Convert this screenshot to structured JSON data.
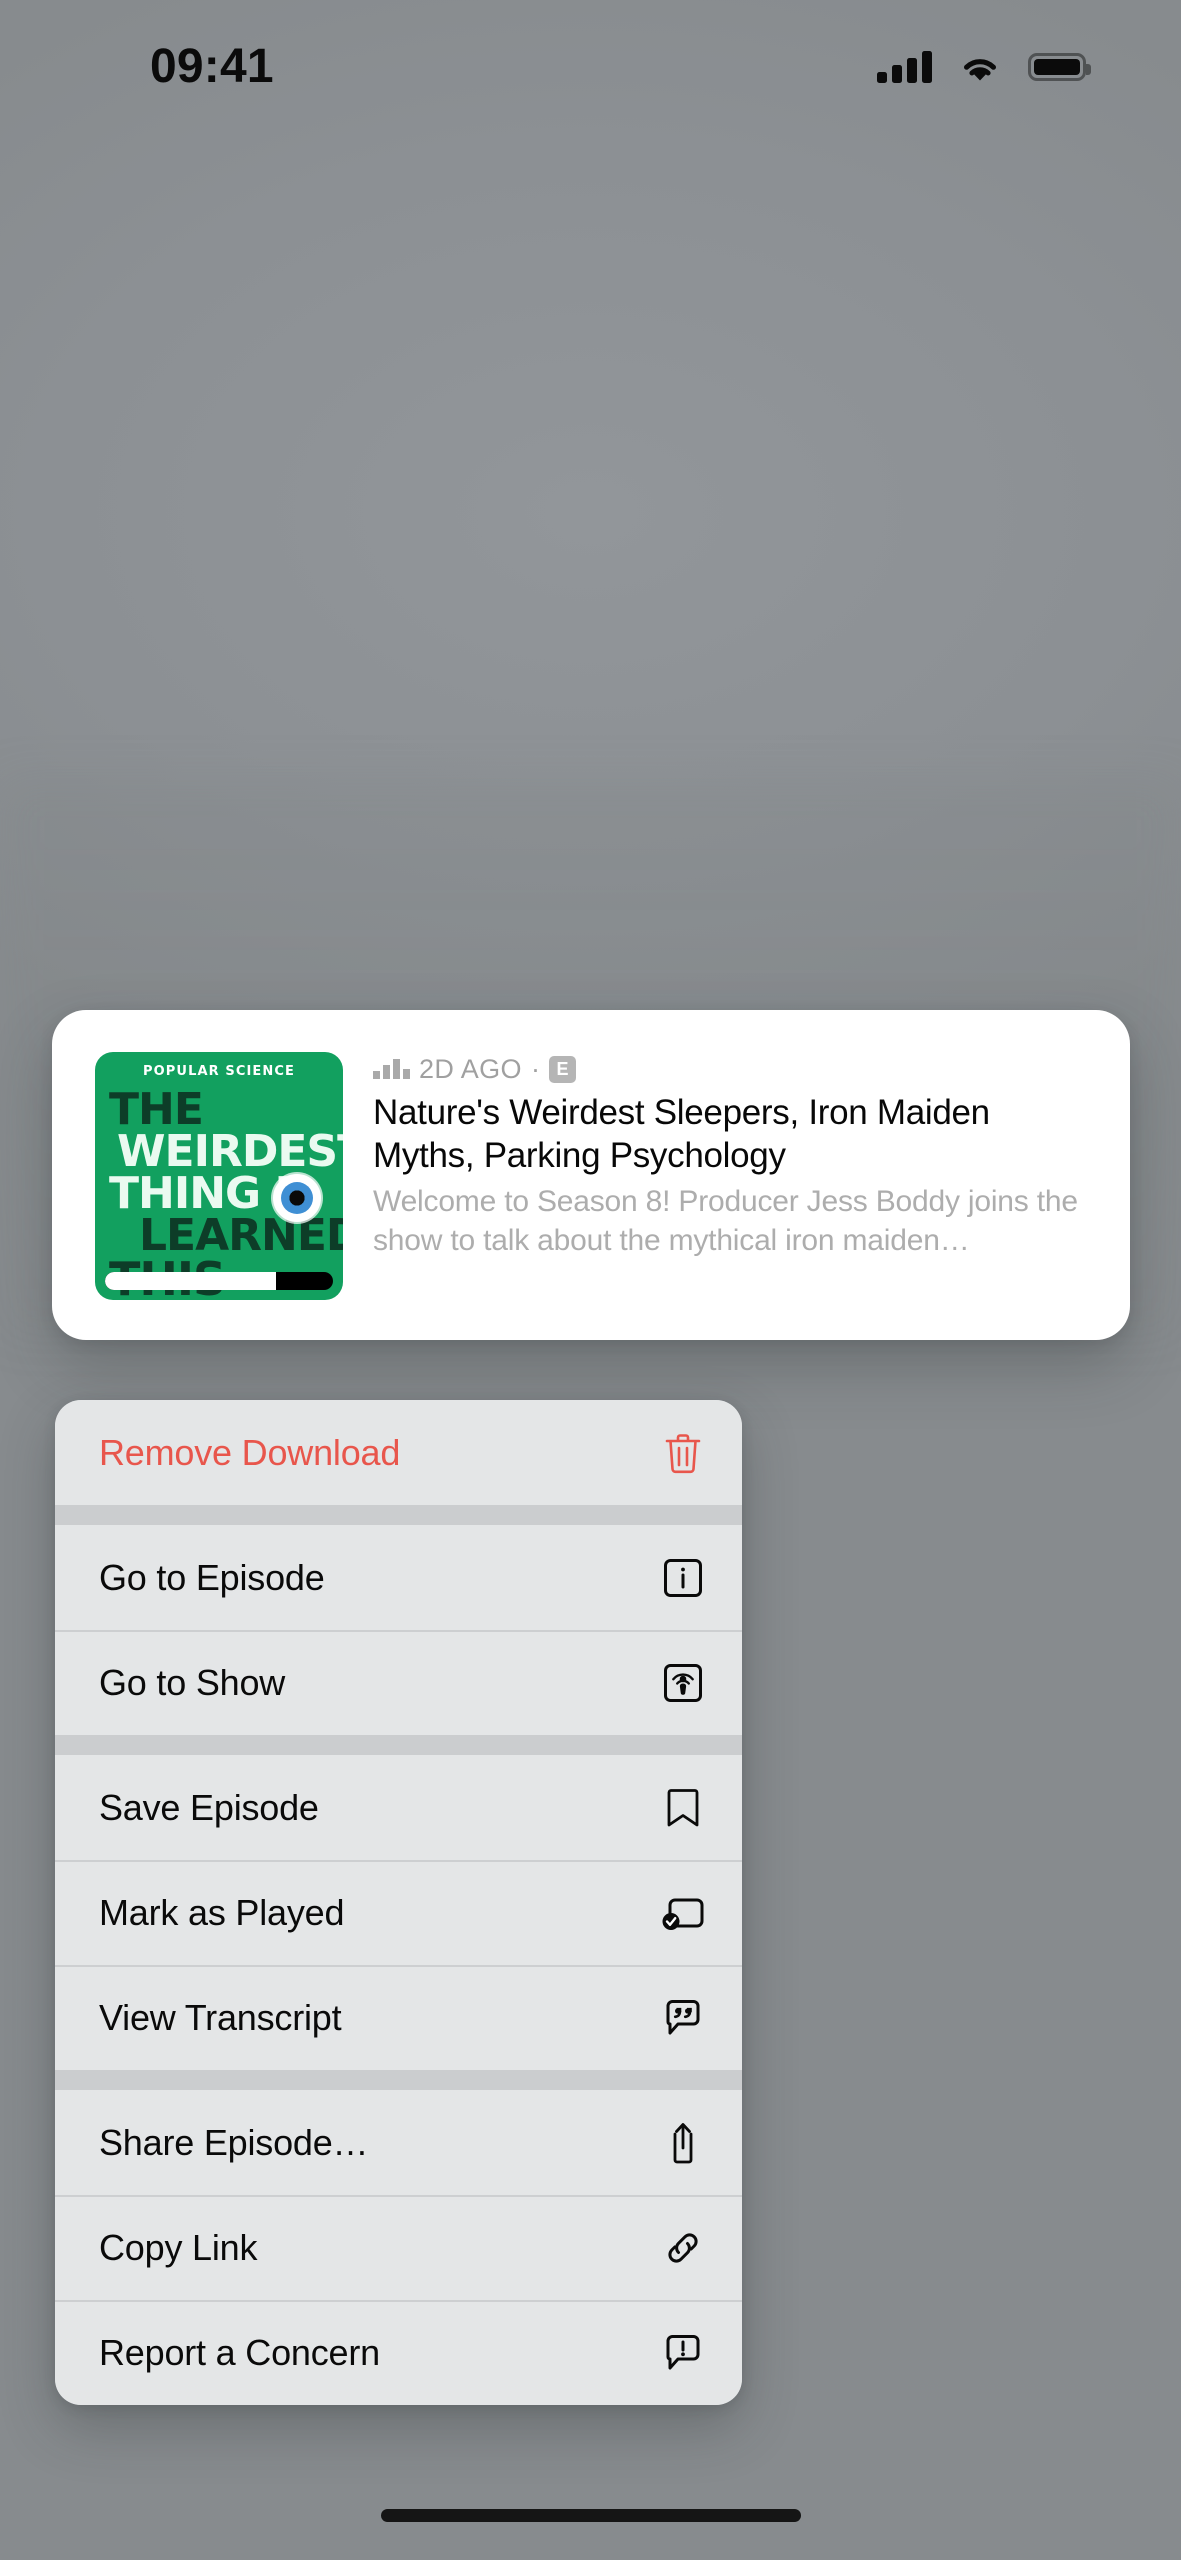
{
  "status_bar": {
    "time": "09:41",
    "cellular_icon": "cellular-signal-icon",
    "wifi_icon": "wifi-icon",
    "battery_icon": "battery-full-icon"
  },
  "preview_card": {
    "artwork": {
      "publisher": "POPULAR SCIENCE",
      "line1": "THE",
      "line2": "WEIRDEST",
      "line3": "THING I",
      "line4": "LEARNED",
      "line5": "THIS WEEK",
      "background_color": "#12a05f",
      "progress_percent": 75
    },
    "meta": {
      "waveform_icon": "audio-waveform-icon",
      "date": "2D AGO",
      "separator": "·",
      "explicit_badge": "E"
    },
    "title": "Nature's Weirdest Sleepers, Iron Maiden Myths, Parking Psychology",
    "description": "Welcome to Season 8! Producer Jess Boddy joins the show to talk about the mythical iron maiden…"
  },
  "context_menu": {
    "groups": [
      {
        "items": [
          {
            "label": "Remove Download",
            "icon": "trash-icon",
            "destructive": true
          }
        ]
      },
      {
        "items": [
          {
            "label": "Go to Episode",
            "icon": "info-square-icon",
            "destructive": false
          },
          {
            "label": "Go to Show",
            "icon": "podcast-square-icon",
            "destructive": false
          }
        ]
      },
      {
        "items": [
          {
            "label": "Save Episode",
            "icon": "bookmark-icon",
            "destructive": false
          },
          {
            "label": "Mark as Played",
            "icon": "mark-played-checkmark-icon",
            "destructive": false
          },
          {
            "label": "View Transcript",
            "icon": "quote-bubble-icon",
            "destructive": false
          }
        ]
      },
      {
        "items": [
          {
            "label": "Share Episode…",
            "icon": "share-icon",
            "destructive": false
          },
          {
            "label": "Copy Link",
            "icon": "link-icon",
            "destructive": false
          },
          {
            "label": "Report a Concern",
            "icon": "exclamation-bubble-icon",
            "destructive": false
          }
        ]
      }
    ]
  },
  "colors": {
    "destructive": "#e8564c",
    "menu_background": "#e4e6e7",
    "menu_separator": "#cdcfd1",
    "card_background": "#ffffff",
    "backdrop": "#8e9295",
    "artwork_green": "#12a05f"
  },
  "home_indicator": "home-indicator"
}
